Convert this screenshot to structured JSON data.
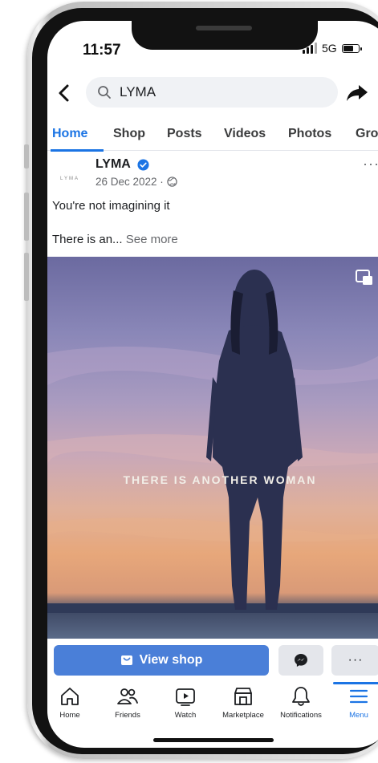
{
  "status_bar": {
    "time": "11:57",
    "network": "5G",
    "battery_level": 0.7
  },
  "header": {
    "back_icon": "chevron-left-icon",
    "search_icon": "magnifier-icon",
    "search_value": "LYMA",
    "share_icon": "share-arrow-icon"
  },
  "tabs": [
    {
      "label": "Home",
      "active": true
    },
    {
      "label": "Shop",
      "active": false
    },
    {
      "label": "Posts",
      "active": false
    },
    {
      "label": "Videos",
      "active": false
    },
    {
      "label": "Photos",
      "active": false
    },
    {
      "label": "Gro",
      "active": false
    }
  ],
  "post": {
    "author": "LYMA",
    "logo_text": "LYMA",
    "date": "26 Dec 2022 ·",
    "text_line1": "You're not imagining it",
    "text_line2": "There is an...",
    "see_more": "See more",
    "more_label": "···"
  },
  "media": {
    "caption": "THERE IS ANOTHER WOMAN",
    "pip_icon": "picture-in-picture-icon"
  },
  "actions": {
    "view_shop": "View shop",
    "more": "···"
  },
  "bottom_nav": [
    {
      "label": "Home",
      "icon": "home-icon",
      "active": false
    },
    {
      "label": "Friends",
      "icon": "friends-icon",
      "active": false
    },
    {
      "label": "Watch",
      "icon": "watch-icon",
      "active": false
    },
    {
      "label": "Marketplace",
      "icon": "marketplace-icon",
      "active": false
    },
    {
      "label": "Notifications",
      "icon": "bell-icon",
      "active": false
    },
    {
      "label": "Menu",
      "icon": "menu-icon",
      "active": true
    }
  ],
  "colors": {
    "accent": "#1b74e4",
    "view_shop_bg": "#4a7fd8",
    "secondary_button_bg": "#e4e6eb"
  }
}
